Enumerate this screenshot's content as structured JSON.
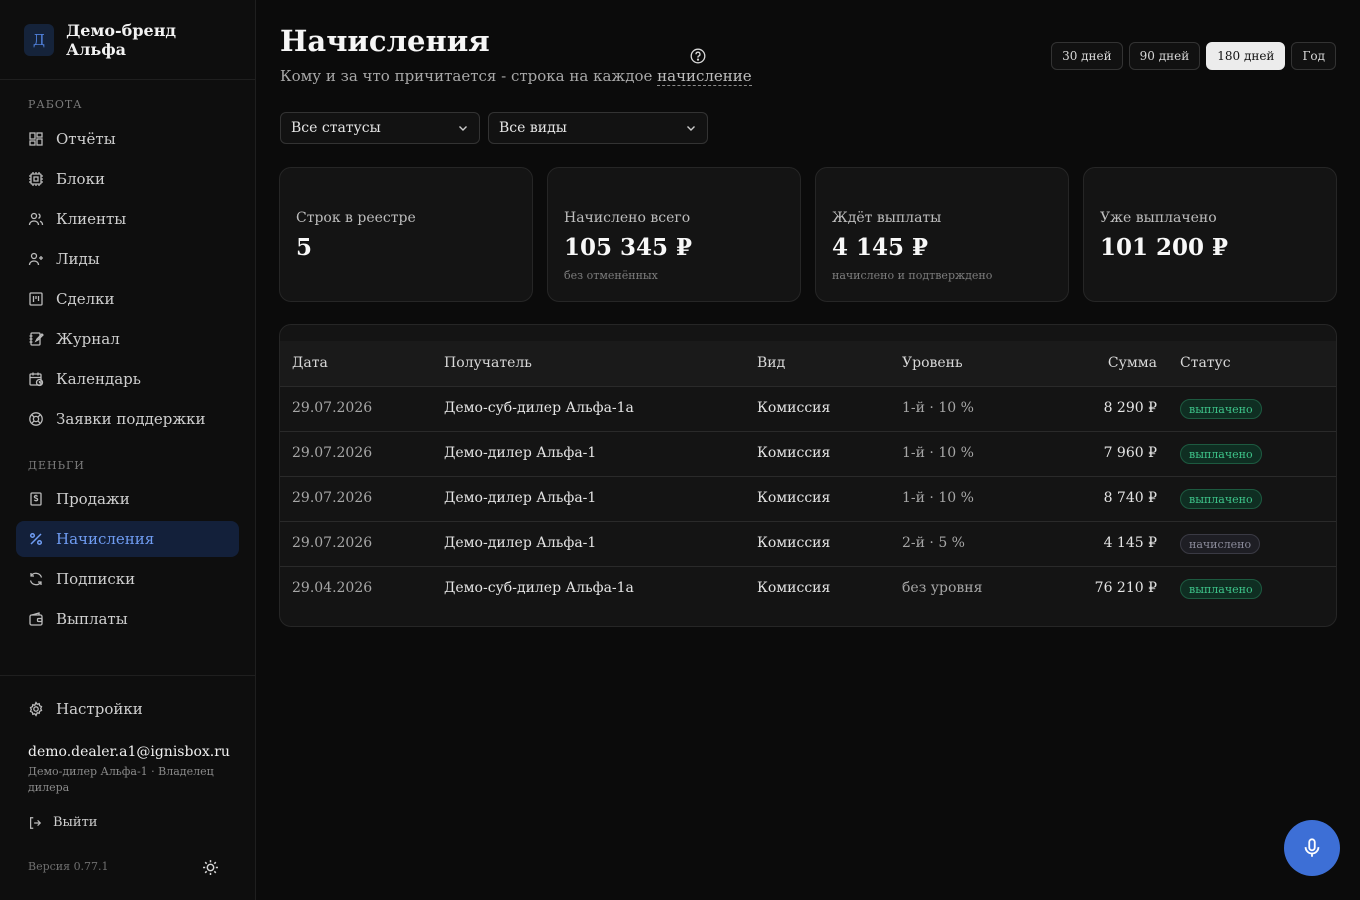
{
  "brand": {
    "initial": "Д",
    "name": "Демо-бренд Альфа"
  },
  "sidebar": {
    "sections": {
      "work": "РАБОТА",
      "money": "ДЕНЬГИ"
    },
    "work_items": [
      {
        "label": "Отчёты",
        "icon": "dashboard-icon"
      },
      {
        "label": "Блоки",
        "icon": "chip-icon"
      },
      {
        "label": "Клиенты",
        "icon": "users-icon"
      },
      {
        "label": "Лиды",
        "icon": "user-plus-icon"
      },
      {
        "label": "Сделки",
        "icon": "kanban-icon"
      },
      {
        "label": "Журнал",
        "icon": "notebook-icon"
      },
      {
        "label": "Календарь",
        "icon": "calendar-clock-icon"
      },
      {
        "label": "Заявки поддержки",
        "icon": "lifebuoy-icon"
      }
    ],
    "money_items": [
      {
        "label": "Продажи",
        "icon": "receipt-icon"
      },
      {
        "label": "Начисления",
        "icon": "percent-icon",
        "active": true
      },
      {
        "label": "Подписки",
        "icon": "refresh-icon"
      },
      {
        "label": "Выплаты",
        "icon": "wallet-icon"
      }
    ],
    "settings": "Настройки",
    "user": {
      "email": "demo.dealer.a1@ignisbox.ru",
      "role": "Демо-дилер Альфа-1 · Владелец дилера"
    },
    "logout": "Выйти",
    "version": "Версия 0.77.1"
  },
  "header": {
    "title": "Начисления",
    "subtitle_prefix": "Кому и за что причитается - строка на каждое ",
    "subtitle_term": "начисление",
    "ranges": [
      {
        "label": "30 дней",
        "active": false
      },
      {
        "label": "90 дней",
        "active": false
      },
      {
        "label": "180 дней",
        "active": true
      },
      {
        "label": "Год",
        "active": false
      }
    ]
  },
  "filters": {
    "status": "Все статусы",
    "kind": "Все виды"
  },
  "stats": [
    {
      "label": "Строк в реестре",
      "value": "5",
      "note": ""
    },
    {
      "label": "Начислено всего",
      "value": "105 345 ₽",
      "note": "без отменённых"
    },
    {
      "label": "Ждёт выплаты",
      "value": "4 145 ₽",
      "note": "начислено и подтверждено"
    },
    {
      "label": "Уже выплачено",
      "value": "101 200 ₽",
      "note": ""
    }
  ],
  "table": {
    "columns": {
      "date": "Дата",
      "recipient": "Получатель",
      "kind": "Вид",
      "level": "Уровень",
      "amount": "Сумма",
      "status": "Статус"
    },
    "rows": [
      {
        "date": "29.07.2026",
        "recipient": "Демо-суб-дилер Альфа-1а",
        "kind": "Комиссия",
        "level": "1-й · 10 %",
        "amount": "8 290 ₽",
        "status": "выплачено",
        "status_type": "paid"
      },
      {
        "date": "29.07.2026",
        "recipient": "Демо-дилер Альфа-1",
        "kind": "Комиссия",
        "level": "1-й · 10 %",
        "amount": "7 960 ₽",
        "status": "выплачено",
        "status_type": "paid"
      },
      {
        "date": "29.07.2026",
        "recipient": "Демо-дилер Альфа-1",
        "kind": "Комиссия",
        "level": "1-й · 10 %",
        "amount": "8 740 ₽",
        "status": "выплачено",
        "status_type": "paid"
      },
      {
        "date": "29.07.2026",
        "recipient": "Демо-дилер Альфа-1",
        "kind": "Комиссия",
        "level": "2-й · 5 %",
        "amount": "4 145 ₽",
        "status": "начислено",
        "status_type": "accrued"
      },
      {
        "date": "29.04.2026",
        "recipient": "Демо-суб-дилер Альфа-1а",
        "kind": "Комиссия",
        "level": "без уровня",
        "amount": "76 210 ₽",
        "status": "выплачено",
        "status_type": "paid"
      }
    ]
  },
  "colors": {
    "accent": "#3d6fd6",
    "paid": "#3ec48a",
    "active_nav": "#6f9cf2"
  }
}
